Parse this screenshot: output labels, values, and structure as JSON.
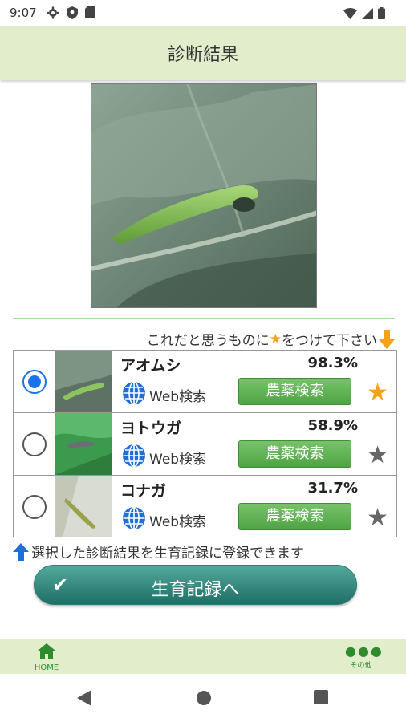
{
  "status_bar": {
    "time": "9:07",
    "icons": [
      "gear-icon",
      "shield-icon",
      "sd-card-icon",
      "wifi-icon",
      "signal-icon",
      "battery-icon"
    ]
  },
  "app_bar": {
    "title": "診断結果"
  },
  "instruction": {
    "prefix": "これだと思うものに",
    "star": "★",
    "suffix": "をつけて下さい"
  },
  "results": [
    {
      "name": "アオムシ",
      "percent": "98.3%",
      "web_label": "Web検索",
      "pesticide_label": "農薬検索",
      "selected": true,
      "starred": true
    },
    {
      "name": "ヨトウガ",
      "percent": "58.9%",
      "web_label": "Web検索",
      "pesticide_label": "農薬検索",
      "selected": false,
      "starred": false
    },
    {
      "name": "コナガ",
      "percent": "31.7%",
      "web_label": "Web検索",
      "pesticide_label": "農薬検索",
      "selected": false,
      "starred": false
    }
  ],
  "note": {
    "text": "選択した診断結果を生育記録に登録できます"
  },
  "record_button": {
    "label": "生育記録へ"
  },
  "bottom_nav": {
    "home_label": "HOME",
    "more_label": "その他"
  },
  "colors": {
    "accent_green": "#4fa444",
    "star_orange": "#f5a21b",
    "star_gray": "#666666",
    "radio_blue": "#1a73e8",
    "header_bg": "#e2edcc",
    "record_teal": "#1f6f66"
  }
}
